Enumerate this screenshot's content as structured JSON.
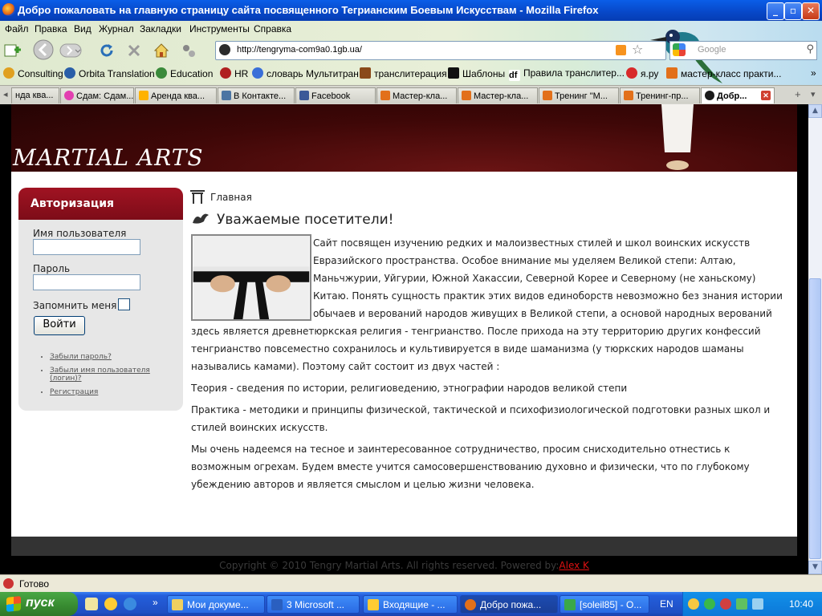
{
  "window": {
    "title": "Добро пожаловать на главную страницу сайта посвященного Тегрианским Боевым Искусствам - Mozilla Firefox"
  },
  "menu": [
    "Файл",
    "Правка",
    "Вид",
    "Журнал",
    "Закладки",
    "Инструменты",
    "Справка"
  ],
  "address_bar": {
    "url": "http://tengryma-com9a0.1gb.ua/",
    "search_placeholder": "Google"
  },
  "bookmarks": [
    {
      "label": "Consulting",
      "icon": "consulting-icon"
    },
    {
      "label": "Orbita Translation",
      "icon": "orbita-icon"
    },
    {
      "label": "Education",
      "icon": "education-icon"
    },
    {
      "label": "HR",
      "icon": "hr-icon"
    },
    {
      "label": "словарь Мультитран",
      "icon": "multitran-icon"
    },
    {
      "label": "транслитерация",
      "icon": "translit-icon"
    },
    {
      "label": "Шаблоны",
      "icon": "templates-icon"
    },
    {
      "label": "Правила транслитер...",
      "icon": "df-icon"
    },
    {
      "label": "я.ру",
      "icon": "ya-icon"
    },
    {
      "label": "мастер-класс практи...",
      "icon": "trn-icon"
    }
  ],
  "tabs": [
    {
      "label": "нда ква...",
      "icon": "generic-tab-icon"
    },
    {
      "label": "Сдам: Сдам...",
      "icon": "slando-icon"
    },
    {
      "label": "Аренда ква...",
      "icon": "olx-icon"
    },
    {
      "label": "В Контакте...",
      "icon": "vk-icon"
    },
    {
      "label": "Facebook",
      "icon": "facebook-icon"
    },
    {
      "label": "Мастер-кла...",
      "icon": "trn-icon"
    },
    {
      "label": "Мастер-кла...",
      "icon": "trn-icon"
    },
    {
      "label": "Тренинг \"М...",
      "icon": "trn-icon"
    },
    {
      "label": "Тренинг-пр...",
      "icon": "trn-icon"
    },
    {
      "label": "Добр...",
      "icon": "site-icon",
      "active": true
    }
  ],
  "site": {
    "logo_text": "MARTIAL ARTS",
    "login": {
      "title": "Авторизация",
      "username_label": "Имя пользователя",
      "password_label": "Пароль",
      "remember_label": "Запомнить меня",
      "submit_label": "Войти",
      "links": [
        "Забыли пароль?",
        "Забыли имя пользователя (логин)?",
        "Регистрация"
      ]
    },
    "breadcrumb": "Главная",
    "heading": "Уважаемые посетители!",
    "paragraphs": [
      "Сайт посвящен изучению редких и малоизвестных стилей и школ воинских искусств Евразийского пространства. Особое внимание мы уделяем Великой степи: Алтаю, Маньчжурии, Уйгурии, Южной Хакассии, Северной Корее и Северному (не ханьскому) Китаю. Понять сущность практик этих видов единоборств невозможно без знания истории обычаев и верований народов живущих в  Великой степи, а основой народных верований здесь является древнетюркская  религия - тенгрианство. После прихода на эту территорию других конфессий тенгрианство повсеместно сохранилось и культивируется в виде шаманизма (у тюркских народов шаманы назывались камами). Поэтому сайт состоит из двух частей :",
      "Теория - сведения по истории, религиоведению, этнографии народов великой степи",
      "Практика  - методики и принципы физической, тактической  и психофизиологической подготовки  разных школ и стилей воинских искусств.",
      "Мы очень надеемся на тесное и заинтересованное  сотрудничество, просим снисходительно отнестись к возможным огрехам. Будем вместе учится самосовершенствованию духовно и физически, что по глубокому убеждению авторов и является смыслом и целью жизни человека."
    ],
    "footer_text": "Copyright © 2010 Tengry Martial Arts. All rights reserved. Powered by:",
    "footer_link": "Alex K"
  },
  "status": "Готово",
  "taskbar": {
    "start_label": "пуск",
    "items": [
      {
        "label": "Мои докуме...",
        "icon": "folder-icon"
      },
      {
        "label": "3 Microsoft ...",
        "icon": "word-icon"
      },
      {
        "label": "Входящие - ...",
        "icon": "mail-icon"
      },
      {
        "label": "Добро пожа...",
        "icon": "firefox-icon",
        "active": true
      },
      {
        "label": "[soleil85] - О...",
        "icon": "chat-icon"
      }
    ],
    "language": "EN",
    "clock": "10:40"
  },
  "colors": {
    "login_header": "#8b0f1d",
    "banner": "#4a0a0a",
    "footer_link": "#dd1111"
  }
}
